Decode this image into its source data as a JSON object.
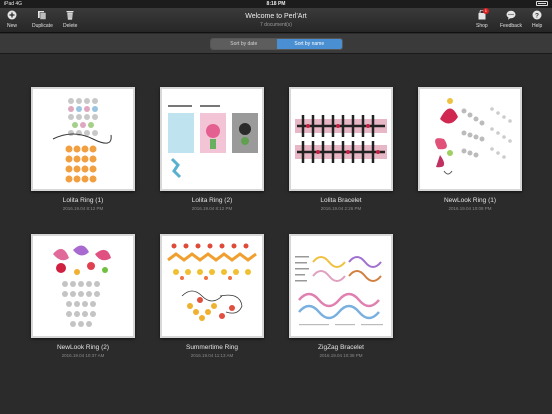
{
  "status": {
    "carrier": "iPad",
    "network": "4G",
    "time": "8:18 PM",
    "battery": ""
  },
  "toolbar": {
    "new_label": "New",
    "duplicate_label": "Duplicate",
    "delete_label": "Delete",
    "title": "Welcome to Perl'Art",
    "subtitle": "7 document(s)",
    "shop_label": "Shop",
    "shop_badge": "1",
    "feedback_label": "Feedback",
    "help_label": "Help"
  },
  "sort": {
    "by_date": "Sort by date",
    "by_name": "Sort by name",
    "active": "by_name"
  },
  "documents": [
    {
      "name": "Lolita Ring (1)",
      "date": "2016.19.04 8:12 PM"
    },
    {
      "name": "Lolita Ring (2)",
      "date": "2016.19.04 8:12 PM"
    },
    {
      "name": "Lolita Bracelet",
      "date": "2016.19.04 2:26 PM"
    },
    {
      "name": "NewLook Ring (1)",
      "date": "2016.19.04 10:08 PM"
    },
    {
      "name": "NewLook Ring (2)",
      "date": "2016.19.04 10:37 AM"
    },
    {
      "name": "Summertime Ring",
      "date": "2016.19.04 11:13 AM"
    },
    {
      "name": "ZigZag Bracelet",
      "date": "2016.19.04 10:38 PM"
    }
  ],
  "colors": {
    "accent": "#4a8fd1",
    "badge": "#e02020",
    "background": "#2b2b2b"
  }
}
